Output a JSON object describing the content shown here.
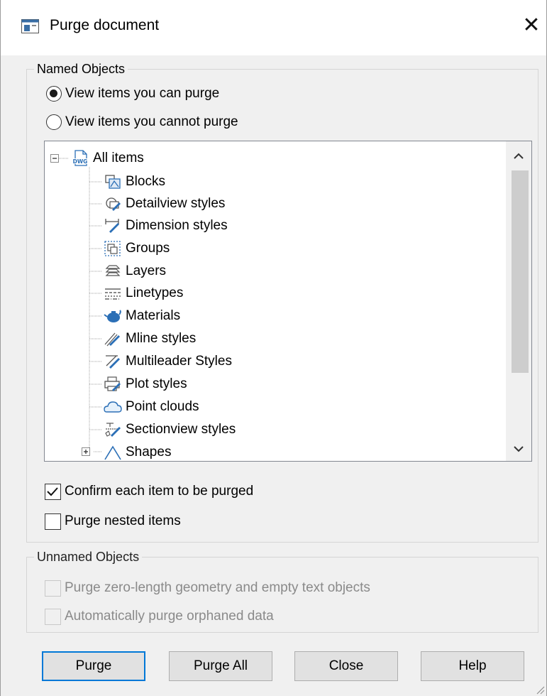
{
  "window": {
    "title": "Purge document",
    "close_glyph": "✕",
    "app_icon": "dialog-window-icon"
  },
  "named_objects": {
    "legend": "Named Objects",
    "radio_can_purge": {
      "label": "View items you can purge",
      "selected": true
    },
    "radio_cannot_purge": {
      "label": "View items you cannot purge",
      "selected": false
    },
    "tree": {
      "root": {
        "label": "All items",
        "icon": "dwg-file-icon",
        "expanded": true
      },
      "items": [
        {
          "label": "Blocks",
          "icon": "blocks-icon"
        },
        {
          "label": "Detailview styles",
          "icon": "detailview-styles-icon"
        },
        {
          "label": "Dimension styles",
          "icon": "dimension-styles-icon"
        },
        {
          "label": "Groups",
          "icon": "groups-icon"
        },
        {
          "label": "Layers",
          "icon": "layers-icon"
        },
        {
          "label": "Linetypes",
          "icon": "linetypes-icon"
        },
        {
          "label": "Materials",
          "icon": "materials-icon"
        },
        {
          "label": "Mline styles",
          "icon": "mline-styles-icon"
        },
        {
          "label": "Multileader Styles",
          "icon": "multileader-styles-icon"
        },
        {
          "label": "Plot styles",
          "icon": "plot-styles-icon"
        },
        {
          "label": "Point clouds",
          "icon": "point-clouds-icon"
        },
        {
          "label": "Sectionview styles",
          "icon": "sectionview-styles-icon"
        },
        {
          "label": "Shapes",
          "icon": "shapes-icon",
          "expandable": true
        }
      ],
      "scroll_up_glyph": "^",
      "scroll_down_glyph": "v"
    },
    "confirm_each": {
      "label": "Confirm each item to be purged",
      "checked": true
    },
    "purge_nested": {
      "label": "Purge nested items",
      "checked": false
    }
  },
  "unnamed_objects": {
    "legend": "Unnamed Objects",
    "zero_length": {
      "label": "Purge zero-length geometry and  empty text objects",
      "checked": false,
      "enabled": false
    },
    "orphaned": {
      "label": "Automatically purge orphaned data",
      "checked": false,
      "enabled": false
    }
  },
  "buttons": {
    "purge": "Purge",
    "purge_all": "Purge All",
    "close": "Close",
    "help": "Help"
  },
  "colors": {
    "window_bg": "#f0f0f0",
    "default_button_border": "#0078d7",
    "icon_blue": "#2b6fb6",
    "disabled_text": "#8a8a8a"
  }
}
